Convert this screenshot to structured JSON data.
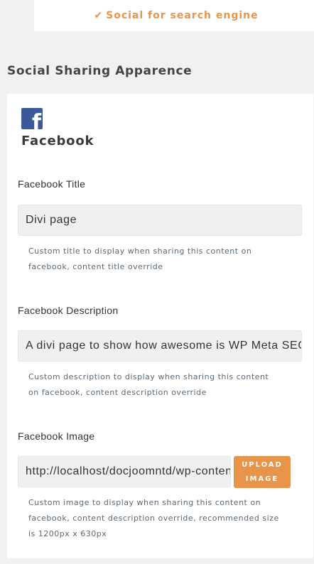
{
  "top_tab": {
    "icon": "check-icon",
    "label": "Social for search engine",
    "color": "#e8954a"
  },
  "section_title": "Social Sharing Apparence",
  "facebook": {
    "icon": "facebook-icon",
    "brand_color": "#3b5998",
    "name": "Facebook",
    "title": {
      "label": "Facebook Title",
      "value": "Divi page",
      "help_lines": [
        "Custom title to display when sharing this content on",
        "facebook, content title override"
      ]
    },
    "description": {
      "label": "Facebook Description",
      "value": "A divi page to show how awesome is WP Meta SEO",
      "help_lines": [
        "Custom description to display when sharing this content",
        "on facebook, content description override"
      ]
    },
    "image": {
      "label": "Facebook Image",
      "value": "http://localhost/docjoomntd/wp-content/uploads/",
      "button_lines": [
        "UPLOAD",
        "IMAGE"
      ],
      "help_lines": [
        "Custom image to display when sharing this content on",
        "facebook, content description override, recommended size",
        "is 1200px x 630px"
      ]
    }
  },
  "accent_color": "#e8954a"
}
